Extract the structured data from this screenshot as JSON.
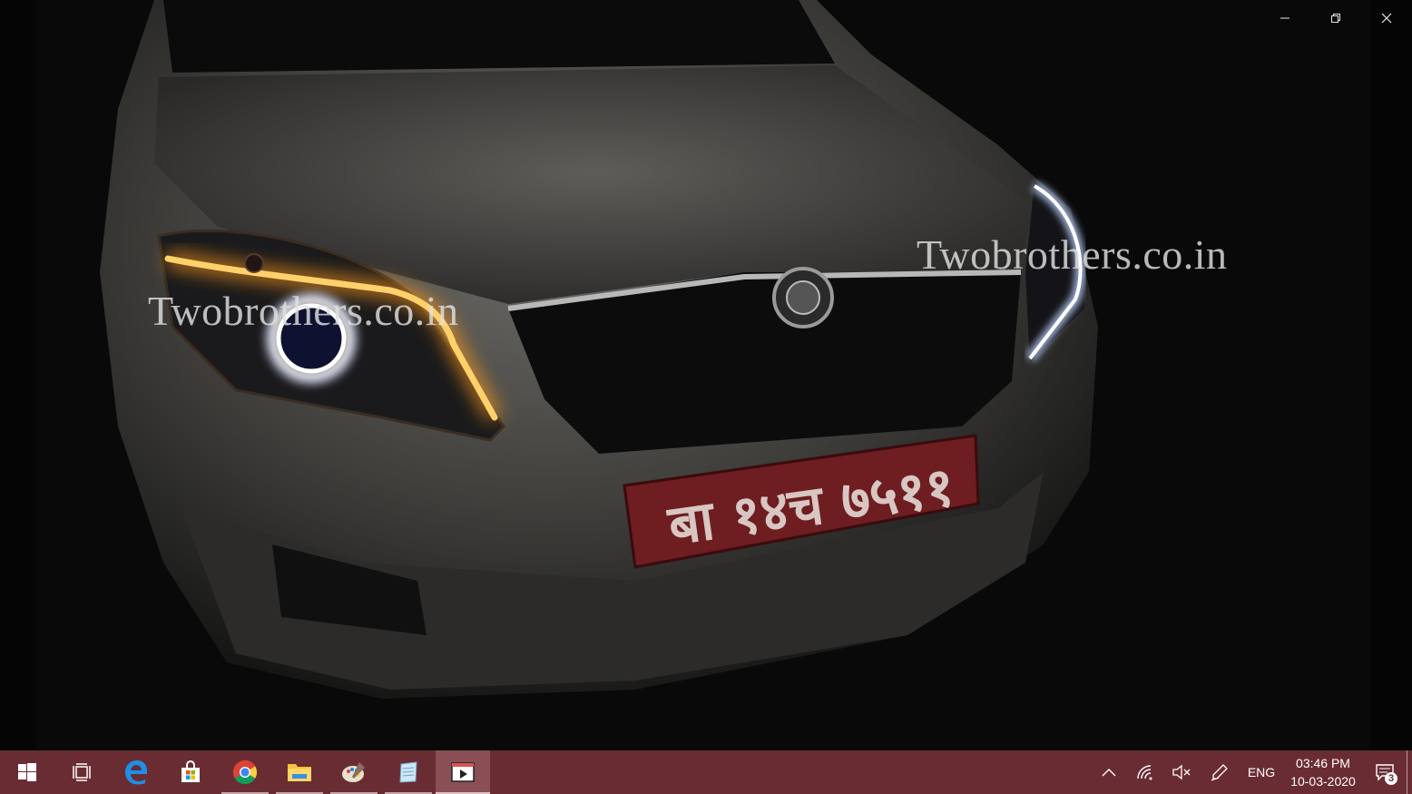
{
  "viewer": {
    "watermark_left": "Twobrothers.co.in",
    "watermark_right": "Twobrothers.co.in",
    "plate_text": "बा १४च ७५११"
  },
  "window_controls": {
    "minimize": "minimize-icon",
    "restore": "restore-icon",
    "close": "close-icon"
  },
  "taskbar": {
    "apps": [
      {
        "icon": "windows-start-icon"
      },
      {
        "icon": "task-view-icon"
      },
      {
        "icon": "edge-icon"
      },
      {
        "icon": "store-icon"
      },
      {
        "icon": "chrome-icon"
      },
      {
        "icon": "file-explorer-icon"
      },
      {
        "icon": "paint-icon"
      },
      {
        "icon": "notepad-icon"
      },
      {
        "icon": "video-player-icon"
      }
    ],
    "tray": {
      "language": "ENG",
      "time": "03:46 PM",
      "date": "10-03-2020",
      "notification_count": "3"
    },
    "accent": "#6a2c33"
  }
}
